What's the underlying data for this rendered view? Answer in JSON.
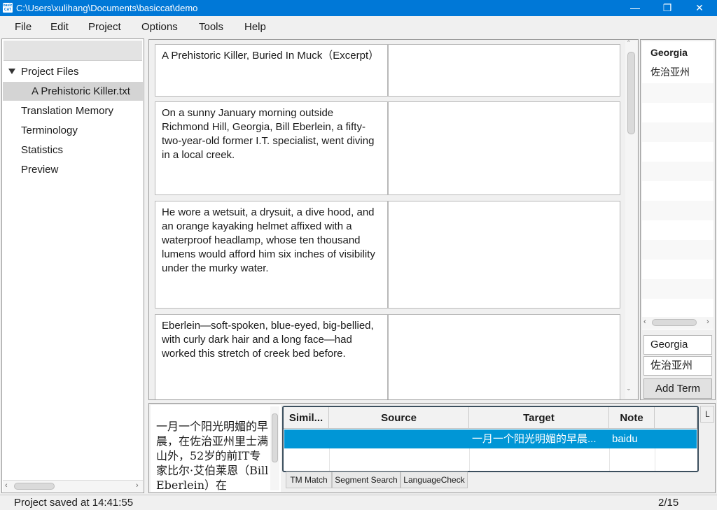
{
  "window": {
    "title": "C:\\Users\\xulihang\\Documents\\basiccat\\demo",
    "app_icon": "basiccat-app-icon"
  },
  "menu": [
    "File",
    "Edit",
    "Project",
    "Options",
    "Tools",
    "Help"
  ],
  "tree": {
    "project_files": "Project Files",
    "file": "A Prehistoric Killer.txt",
    "items": [
      "Translation Memory",
      "Terminology",
      "Statistics",
      "Preview"
    ]
  },
  "segments": [
    {
      "source": "A Prehistoric Killer, Buried In Muck（Excerpt）",
      "target": ""
    },
    {
      "source": "On a sunny January morning outside Richmond Hill, Georgia, Bill Eberlein, a fifty-two-year-old former I.T. specialist, went diving in a local creek.",
      "target": ""
    },
    {
      "source": "He wore a wetsuit, a drysuit, a dive hood, and an orange kayaking helmet affixed with a waterproof headlamp, whose ten thousand lumens would afford him six inches of visibility under the murky water.",
      "target": ""
    },
    {
      "source": "Eberlein—soft-spoken, blue-eyed, big-bellied, with curly dark hair and a long face—had worked this stretch of creek bed before.",
      "target": ""
    }
  ],
  "terms": {
    "list": [
      {
        "source": "Georgia",
        "target": "佐治亚州"
      }
    ],
    "source_input": "Georgia",
    "target_input": "佐治亚州",
    "add_button": "Add Term"
  },
  "preview": {
    "text": "一月一个阳光明媚的早晨，在佐治亚州里士满山外，52岁的前IT专家比尔·艾伯莱恩（Bill Eberlein）在"
  },
  "tm_table": {
    "columns": [
      "Simil...",
      "Source",
      "Target",
      "Note"
    ],
    "rows": [
      {
        "similarity": "",
        "source": "",
        "target": "一月一个阳光明媚的早晨...",
        "note": "baidu"
      }
    ],
    "right_stub": "L"
  },
  "tabs": [
    "TM Match",
    "Segment Search",
    "LanguageCheck"
  ],
  "status": {
    "message": "Project saved at 14:41:55",
    "position": "2/15"
  },
  "colors": {
    "titlebar": "#0078d7",
    "selection": "#0096d6"
  }
}
